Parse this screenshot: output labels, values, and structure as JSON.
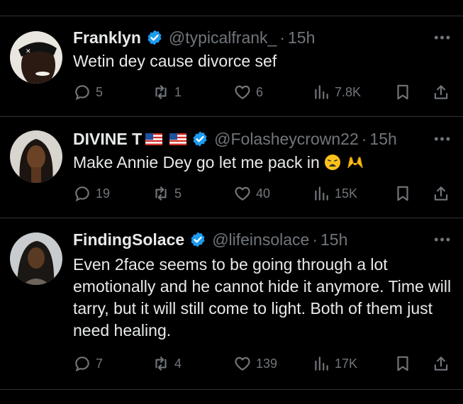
{
  "tweets": [
    {
      "name": "Franklyn",
      "handle": "@typicalfrank_",
      "separator": "·",
      "time": "15h",
      "text": "Wetin dey cause divorce sef",
      "replies": "5",
      "retweets": "1",
      "likes": "6",
      "views": "7.8K"
    },
    {
      "name": "DIVINE T",
      "flags": [
        "flag-usa-icon",
        "flag-usa-icon"
      ],
      "handle": "@Folasheycrown22",
      "separator": "·",
      "time": "15h",
      "text": "Make Annie Dey go let me pack in",
      "emojis": [
        "weary-face-icon",
        "raised-hands-icon"
      ],
      "replies": "19",
      "retweets": "5",
      "likes": "40",
      "views": "15K"
    },
    {
      "name": "FindingSolace",
      "handle": "@lifeinsolace",
      "separator": "·",
      "time": "15h",
      "text": "Even 2face seems to be going through a lot emotionally and he cannot hide it anymore. Time will tarry, but it will still come to light. Both of them just need healing.",
      "replies": "7",
      "retweets": "4",
      "likes": "139",
      "views": "17K"
    }
  ],
  "colors": {
    "background": "#000000",
    "text": "#e7e9ea",
    "muted": "#71767b",
    "verified": "#1d9bf0",
    "divider": "#2f3336"
  }
}
